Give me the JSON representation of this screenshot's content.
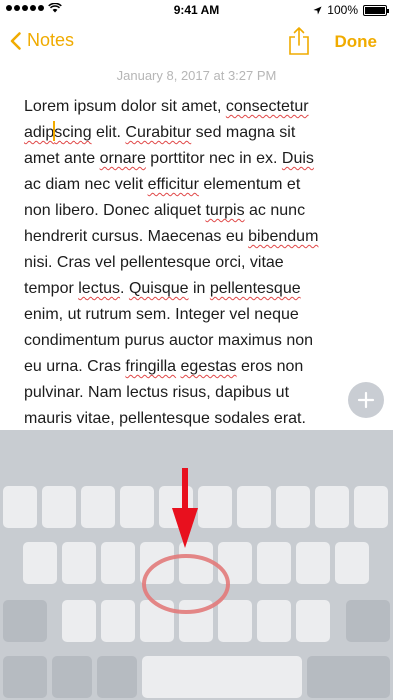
{
  "status_bar": {
    "time": "9:41 AM",
    "battery": "100%"
  },
  "nav": {
    "back_label": "Notes",
    "done_label": "Done"
  },
  "note": {
    "date": "January 8, 2017 at 3:27 PM",
    "lines": [
      [
        {
          "t": "Lorem ipsum dolor sit amet, "
        },
        {
          "t": "consectetur",
          "s": true
        }
      ],
      [
        {
          "t": "adip",
          "s": true
        },
        {
          "caret": true
        },
        {
          "t": "scing",
          "s": true
        },
        {
          "t": " elit. "
        },
        {
          "t": "Curabitur",
          "s": true
        },
        {
          "t": " sed magna sit"
        }
      ],
      [
        {
          "t": "amet ante "
        },
        {
          "t": "ornare",
          "s": true
        },
        {
          "t": " porttitor nec in ex. "
        },
        {
          "t": "Duis",
          "s": true
        }
      ],
      [
        {
          "t": "ac diam nec velit "
        },
        {
          "t": "efficitur",
          "s": true
        },
        {
          "t": " elementum et"
        }
      ],
      [
        {
          "t": "non libero. Donec aliquet "
        },
        {
          "t": "turpis",
          "s": true
        },
        {
          "t": " ac nunc"
        }
      ],
      [
        {
          "t": "hendrerit cursus. Maecenas eu "
        },
        {
          "t": "bibendum",
          "s": true
        }
      ],
      [
        {
          "t": "nisi. Cras vel pellentesque orci, vitae"
        }
      ],
      [
        {
          "t": "tempor "
        },
        {
          "t": "lectus",
          "s": true
        },
        {
          "t": ". "
        },
        {
          "t": "Quisque",
          "s": true
        },
        {
          "t": " in "
        },
        {
          "t": "pellentesque",
          "s": true
        }
      ],
      [
        {
          "t": "enim, ut rutrum sem. Integer vel neque"
        }
      ],
      [
        {
          "t": "condimentum purus auctor maximus non"
        }
      ],
      [
        {
          "t": "eu urna. Cras "
        },
        {
          "t": "fringilla",
          "s": true
        },
        {
          "t": " "
        },
        {
          "t": "egestas",
          "s": true
        },
        {
          "t": " eros non"
        }
      ],
      [
        {
          "t": "pulvinar. Nam lectus risus, dapibus ut"
        }
      ],
      [
        {
          "t": "mauris vitae, pellentesque sodales erat."
        }
      ]
    ]
  },
  "colors": {
    "accent": "#f0ab00",
    "keyboard_bg": "#c8ccd1",
    "highlight_ring": "#e27a7a",
    "arrow": "#e8101e"
  },
  "icons": {
    "back": "chevron-left-icon",
    "share": "share-icon",
    "add": "plus-icon",
    "arrow": "arrow-down-icon"
  }
}
